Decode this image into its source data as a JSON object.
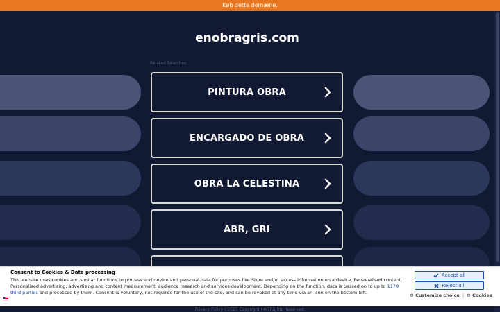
{
  "topbar": {
    "text": "Køb dette domæne."
  },
  "site": {
    "domain": "enobragris.com",
    "related_label": "Related Searches:"
  },
  "searches": [
    {
      "label": "PINTURA OBRA"
    },
    {
      "label": "ENCARGADO DE OBRA"
    },
    {
      "label": "OBRA LA CELESTINA"
    },
    {
      "label": "ABR, GRI"
    },
    {
      "label": ""
    }
  ],
  "footer": {
    "privacy": "Privacy Policy",
    "copyright": "2025 Copyright | All Rights Reserved."
  },
  "consent": {
    "title": "Consent to Cookies & Data processing",
    "body_start": "This website uses cookies and similar functions to process end device and personal data for purposes like Store and/or access information on a device, Personalised content, Personalised advertising, advertising and content measurement, audience research and services development. Depending on the function, data is passed on to up to ",
    "link": "1178 third parties",
    "body_end": " and processed by them. Consent is voluntary, not required for the use of the site, and can be revoked at any time via an icon on the bottom left.",
    "accept_label": "Accept all",
    "reject_label": "Reject all",
    "customize_label": "Customize choice",
    "cookies_label": "Cookies"
  },
  "colors": {
    "accent": "#e87722",
    "background": "#121a33",
    "consent_blue": "#1a4fb5"
  }
}
